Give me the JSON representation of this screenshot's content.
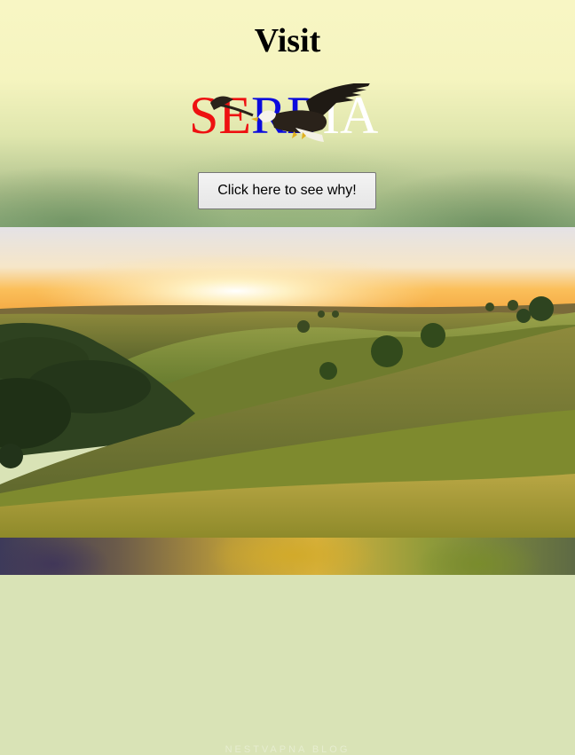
{
  "hero": {
    "title": "Visit",
    "logo": {
      "segments": [
        {
          "text": "SE",
          "color": "#ee1111"
        },
        {
          "text": "RB",
          "color": "#0b0bdd"
        },
        {
          "text": "IA",
          "color": "#ffffff"
        }
      ],
      "icon": "eagle-icon"
    },
    "button_label": "Click here to see why!"
  },
  "landscape": {
    "watermark": "NESTVAPNA BLOG"
  }
}
